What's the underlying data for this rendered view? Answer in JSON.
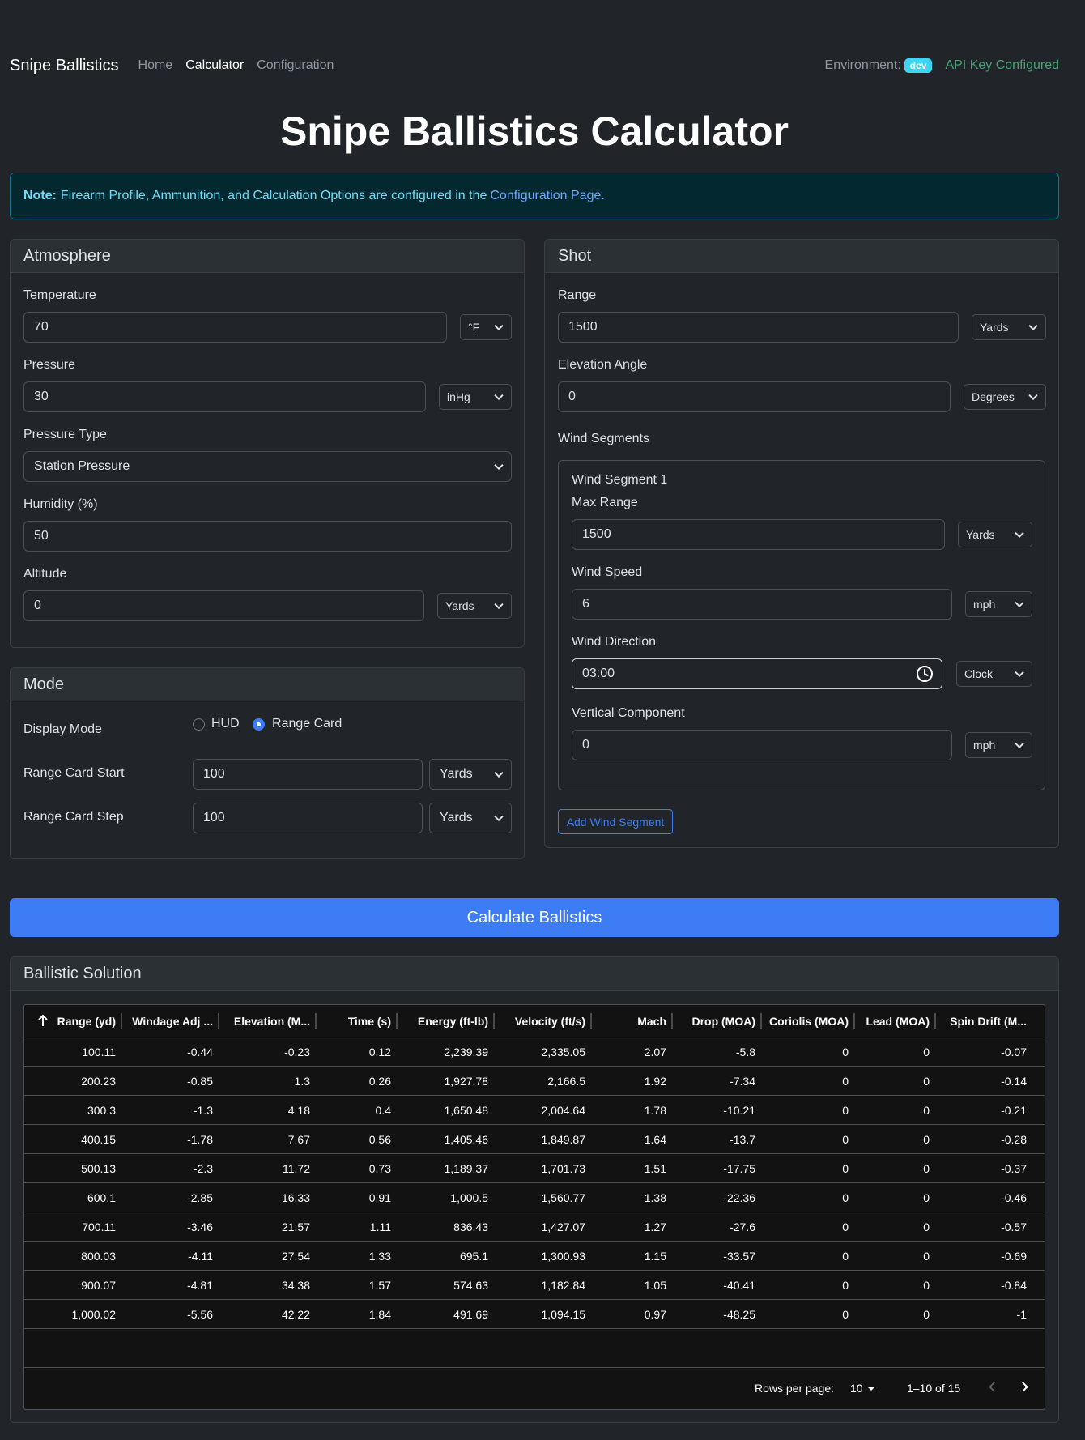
{
  "navbar": {
    "brand": "Snipe Ballistics",
    "links": [
      "Home",
      "Calculator",
      "Configuration"
    ],
    "environment_label": "Environment:",
    "environment_badge": "dev",
    "api_status": "API Key Configured"
  },
  "page_title": "Snipe Ballistics Calculator",
  "note": {
    "bold": "Note:",
    "text": "Firearm Profile, Ammunition, and Calculation Options are configured in the",
    "link": "Configuration Page",
    "end": "."
  },
  "atmosphere": {
    "title": "Atmosphere",
    "temperature": {
      "label": "Temperature",
      "value": "70",
      "unit": "°F"
    },
    "pressure": {
      "label": "Pressure",
      "value": "30",
      "unit": "inHg"
    },
    "pressure_type": {
      "label": "Pressure Type",
      "value": "Station Pressure"
    },
    "humidity": {
      "label": "Humidity (%)",
      "value": "50"
    },
    "altitude": {
      "label": "Altitude",
      "value": "0",
      "unit": "Yards"
    }
  },
  "mode": {
    "title": "Mode",
    "display_mode": {
      "label": "Display Mode",
      "options": [
        "HUD",
        "Range Card"
      ],
      "selected": "Range Card"
    },
    "range_card_start": {
      "label": "Range Card Start",
      "value": "100",
      "unit": "Yards"
    },
    "range_card_step": {
      "label": "Range Card Step",
      "value": "100",
      "unit": "Yards"
    }
  },
  "shot": {
    "title": "Shot",
    "range": {
      "label": "Range",
      "value": "1500",
      "unit": "Yards"
    },
    "elevation_angle": {
      "label": "Elevation Angle",
      "value": "0",
      "unit": "Degrees"
    },
    "wind_segments_label": "Wind Segments",
    "segment": {
      "title": "Wind Segment 1",
      "max_range": {
        "label": "Max Range",
        "value": "1500",
        "unit": "Yards"
      },
      "wind_speed": {
        "label": "Wind Speed",
        "value": "6",
        "unit": "mph"
      },
      "wind_direction": {
        "label": "Wind Direction",
        "value": "03:00",
        "unit": "Clock"
      },
      "vertical_component": {
        "label": "Vertical Component",
        "value": "0",
        "unit": "mph"
      }
    },
    "add_wind_segment": "Add Wind Segment"
  },
  "calculate_button": "Calculate Ballistics",
  "solution": {
    "title": "Ballistic Solution",
    "columns": [
      "Range (yd)",
      "Windage Adj ...",
      "Elevation (M...",
      "Time (s)",
      "Energy (ft-lb)",
      "Velocity (ft/s)",
      "Mach",
      "Drop (MOA)",
      "Coriolis (MOA)",
      "Lead (MOA)",
      "Spin Drift (M..."
    ],
    "rows": [
      [
        "100.11",
        "-0.44",
        "-0.23",
        "0.12",
        "2,239.39",
        "2,335.05",
        "2.07",
        "-5.8",
        "0",
        "0",
        "-0.07"
      ],
      [
        "200.23",
        "-0.85",
        "1.3",
        "0.26",
        "1,927.78",
        "2,166.5",
        "1.92",
        "-7.34",
        "0",
        "0",
        "-0.14"
      ],
      [
        "300.3",
        "-1.3",
        "4.18",
        "0.4",
        "1,650.48",
        "2,004.64",
        "1.78",
        "-10.21",
        "0",
        "0",
        "-0.21"
      ],
      [
        "400.15",
        "-1.78",
        "7.67",
        "0.56",
        "1,405.46",
        "1,849.87",
        "1.64",
        "-13.7",
        "0",
        "0",
        "-0.28"
      ],
      [
        "500.13",
        "-2.3",
        "11.72",
        "0.73",
        "1,189.37",
        "1,701.73",
        "1.51",
        "-17.75",
        "0",
        "0",
        "-0.37"
      ],
      [
        "600.1",
        "-2.85",
        "16.33",
        "0.91",
        "1,000.5",
        "1,560.77",
        "1.38",
        "-22.36",
        "0",
        "0",
        "-0.46"
      ],
      [
        "700.11",
        "-3.46",
        "21.57",
        "1.11",
        "836.43",
        "1,427.07",
        "1.27",
        "-27.6",
        "0",
        "0",
        "-0.57"
      ],
      [
        "800.03",
        "-4.11",
        "27.54",
        "1.33",
        "695.1",
        "1,300.93",
        "1.15",
        "-33.57",
        "0",
        "0",
        "-0.69"
      ],
      [
        "900.07",
        "-4.81",
        "34.38",
        "1.57",
        "574.63",
        "1,182.84",
        "1.05",
        "-40.41",
        "0",
        "0",
        "-0.84"
      ],
      [
        "1,000.02",
        "-5.56",
        "42.22",
        "1.84",
        "491.69",
        "1,094.15",
        "0.97",
        "-48.25",
        "0",
        "0",
        "-1"
      ]
    ],
    "pagination": {
      "rows_per_page_label": "Rows per page:",
      "rows_per_page": "10",
      "range_text": "1–10 of 15"
    }
  }
}
